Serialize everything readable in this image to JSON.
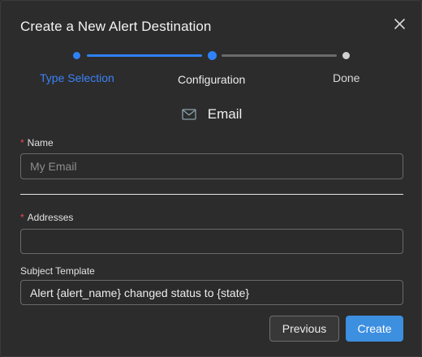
{
  "dialog": {
    "title": "Create a New Alert Destination"
  },
  "steps": [
    {
      "label": "Type Selection",
      "state": "done"
    },
    {
      "label": "Configuration",
      "state": "current"
    },
    {
      "label": "Done",
      "state": "pending"
    }
  ],
  "destination": {
    "type_label": "Email",
    "icon": "mail-icon"
  },
  "form": {
    "name": {
      "label": "Name",
      "required": true,
      "value": "",
      "placeholder": "My Email"
    },
    "addresses": {
      "label": "Addresses",
      "required": true,
      "value": "",
      "placeholder": ""
    },
    "subject_template": {
      "label": "Subject Template",
      "required": false,
      "value": "Alert {alert_name} changed status to {state}"
    }
  },
  "buttons": {
    "previous": "Previous",
    "create": "Create"
  },
  "colors": {
    "accent": "#3d8fe0",
    "step_active": "#2f81f7",
    "required": "#e5484d",
    "background": "#2c2c2c"
  }
}
